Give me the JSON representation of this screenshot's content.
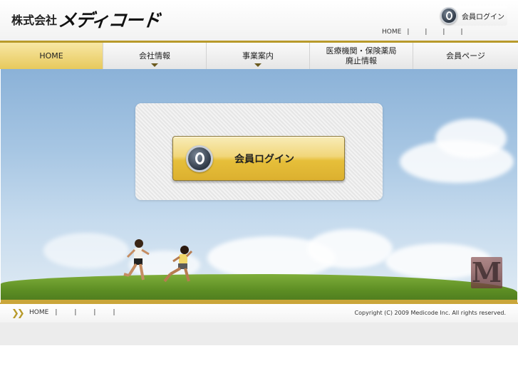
{
  "header": {
    "logo_kanji": "株式会社",
    "logo_kana": "メディコード",
    "login_label": "会員ログイン",
    "top_links": [
      "HOME",
      "",
      "",
      "",
      ""
    ]
  },
  "nav": {
    "items": [
      {
        "label": "HOME",
        "active": true,
        "has_submenu": false
      },
      {
        "label": "会社情報",
        "active": false,
        "has_submenu": true
      },
      {
        "label": "事業案内",
        "active": false,
        "has_submenu": true
      },
      {
        "label_line1": "医療機関・保険薬局",
        "label_line2": "廃止情報",
        "active": false,
        "has_submenu": false
      },
      {
        "label": "会員ページ",
        "active": false,
        "has_submenu": false
      }
    ]
  },
  "hero": {
    "login_button_label": "会員ログイン",
    "brand_mark": "M"
  },
  "footer": {
    "links": [
      "HOME",
      "",
      "",
      "",
      ""
    ],
    "copyright": "Copyright (C) 2009 Medicode Inc. All rights reserved."
  },
  "colors": {
    "accent_gold": "#caa63a",
    "nav_active": "#e7c95c",
    "sky": "#a7c6e3",
    "grass": "#5b8c23"
  }
}
